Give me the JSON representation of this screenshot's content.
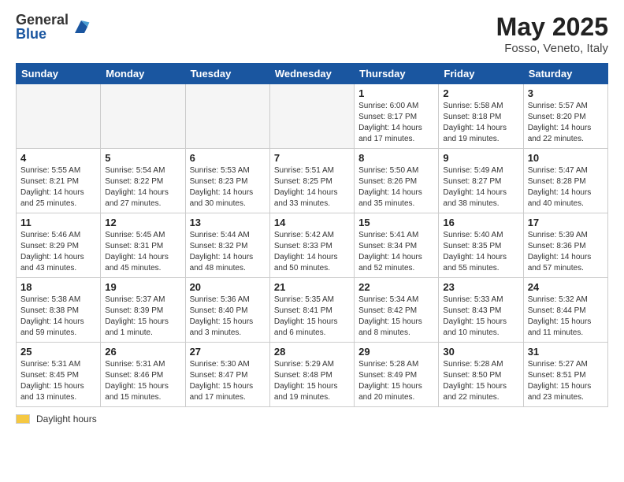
{
  "header": {
    "logo_general": "General",
    "logo_blue": "Blue",
    "month": "May 2025",
    "location": "Fosso, Veneto, Italy"
  },
  "weekdays": [
    "Sunday",
    "Monday",
    "Tuesday",
    "Wednesday",
    "Thursday",
    "Friday",
    "Saturday"
  ],
  "footer": {
    "daylight_label": "Daylight hours"
  },
  "weeks": [
    [
      {
        "day": "",
        "info": ""
      },
      {
        "day": "",
        "info": ""
      },
      {
        "day": "",
        "info": ""
      },
      {
        "day": "",
        "info": ""
      },
      {
        "day": "1",
        "info": "Sunrise: 6:00 AM\nSunset: 8:17 PM\nDaylight: 14 hours\nand 17 minutes."
      },
      {
        "day": "2",
        "info": "Sunrise: 5:58 AM\nSunset: 8:18 PM\nDaylight: 14 hours\nand 19 minutes."
      },
      {
        "day": "3",
        "info": "Sunrise: 5:57 AM\nSunset: 8:20 PM\nDaylight: 14 hours\nand 22 minutes."
      }
    ],
    [
      {
        "day": "4",
        "info": "Sunrise: 5:55 AM\nSunset: 8:21 PM\nDaylight: 14 hours\nand 25 minutes."
      },
      {
        "day": "5",
        "info": "Sunrise: 5:54 AM\nSunset: 8:22 PM\nDaylight: 14 hours\nand 27 minutes."
      },
      {
        "day": "6",
        "info": "Sunrise: 5:53 AM\nSunset: 8:23 PM\nDaylight: 14 hours\nand 30 minutes."
      },
      {
        "day": "7",
        "info": "Sunrise: 5:51 AM\nSunset: 8:25 PM\nDaylight: 14 hours\nand 33 minutes."
      },
      {
        "day": "8",
        "info": "Sunrise: 5:50 AM\nSunset: 8:26 PM\nDaylight: 14 hours\nand 35 minutes."
      },
      {
        "day": "9",
        "info": "Sunrise: 5:49 AM\nSunset: 8:27 PM\nDaylight: 14 hours\nand 38 minutes."
      },
      {
        "day": "10",
        "info": "Sunrise: 5:47 AM\nSunset: 8:28 PM\nDaylight: 14 hours\nand 40 minutes."
      }
    ],
    [
      {
        "day": "11",
        "info": "Sunrise: 5:46 AM\nSunset: 8:29 PM\nDaylight: 14 hours\nand 43 minutes."
      },
      {
        "day": "12",
        "info": "Sunrise: 5:45 AM\nSunset: 8:31 PM\nDaylight: 14 hours\nand 45 minutes."
      },
      {
        "day": "13",
        "info": "Sunrise: 5:44 AM\nSunset: 8:32 PM\nDaylight: 14 hours\nand 48 minutes."
      },
      {
        "day": "14",
        "info": "Sunrise: 5:42 AM\nSunset: 8:33 PM\nDaylight: 14 hours\nand 50 minutes."
      },
      {
        "day": "15",
        "info": "Sunrise: 5:41 AM\nSunset: 8:34 PM\nDaylight: 14 hours\nand 52 minutes."
      },
      {
        "day": "16",
        "info": "Sunrise: 5:40 AM\nSunset: 8:35 PM\nDaylight: 14 hours\nand 55 minutes."
      },
      {
        "day": "17",
        "info": "Sunrise: 5:39 AM\nSunset: 8:36 PM\nDaylight: 14 hours\nand 57 minutes."
      }
    ],
    [
      {
        "day": "18",
        "info": "Sunrise: 5:38 AM\nSunset: 8:38 PM\nDaylight: 14 hours\nand 59 minutes."
      },
      {
        "day": "19",
        "info": "Sunrise: 5:37 AM\nSunset: 8:39 PM\nDaylight: 15 hours\nand 1 minute."
      },
      {
        "day": "20",
        "info": "Sunrise: 5:36 AM\nSunset: 8:40 PM\nDaylight: 15 hours\nand 3 minutes."
      },
      {
        "day": "21",
        "info": "Sunrise: 5:35 AM\nSunset: 8:41 PM\nDaylight: 15 hours\nand 6 minutes."
      },
      {
        "day": "22",
        "info": "Sunrise: 5:34 AM\nSunset: 8:42 PM\nDaylight: 15 hours\nand 8 minutes."
      },
      {
        "day": "23",
        "info": "Sunrise: 5:33 AM\nSunset: 8:43 PM\nDaylight: 15 hours\nand 10 minutes."
      },
      {
        "day": "24",
        "info": "Sunrise: 5:32 AM\nSunset: 8:44 PM\nDaylight: 15 hours\nand 11 minutes."
      }
    ],
    [
      {
        "day": "25",
        "info": "Sunrise: 5:31 AM\nSunset: 8:45 PM\nDaylight: 15 hours\nand 13 minutes."
      },
      {
        "day": "26",
        "info": "Sunrise: 5:31 AM\nSunset: 8:46 PM\nDaylight: 15 hours\nand 15 minutes."
      },
      {
        "day": "27",
        "info": "Sunrise: 5:30 AM\nSunset: 8:47 PM\nDaylight: 15 hours\nand 17 minutes."
      },
      {
        "day": "28",
        "info": "Sunrise: 5:29 AM\nSunset: 8:48 PM\nDaylight: 15 hours\nand 19 minutes."
      },
      {
        "day": "29",
        "info": "Sunrise: 5:28 AM\nSunset: 8:49 PM\nDaylight: 15 hours\nand 20 minutes."
      },
      {
        "day": "30",
        "info": "Sunrise: 5:28 AM\nSunset: 8:50 PM\nDaylight: 15 hours\nand 22 minutes."
      },
      {
        "day": "31",
        "info": "Sunrise: 5:27 AM\nSunset: 8:51 PM\nDaylight: 15 hours\nand 23 minutes."
      }
    ]
  ]
}
